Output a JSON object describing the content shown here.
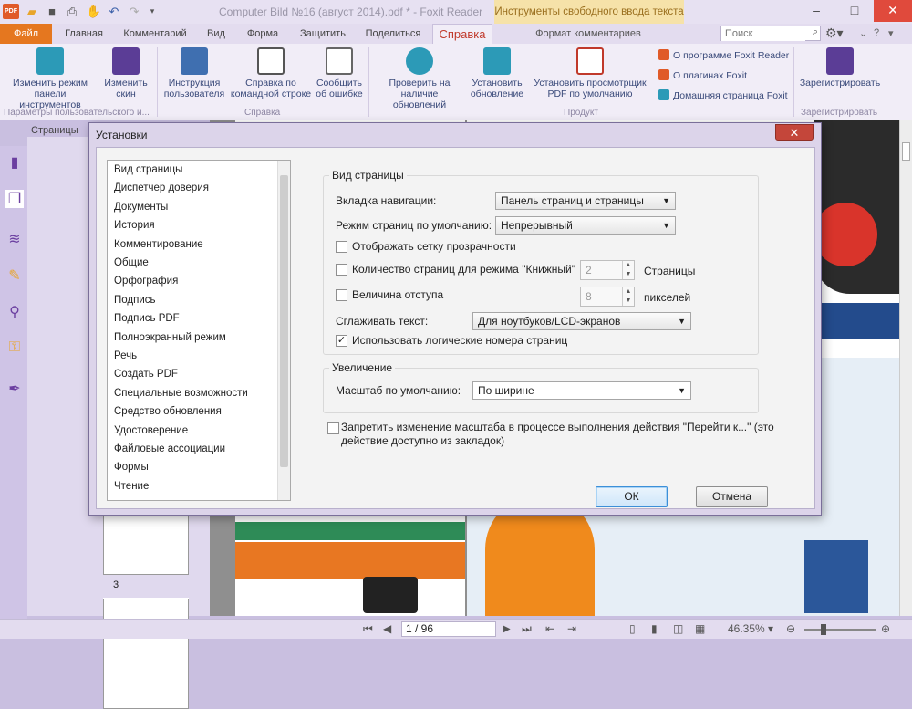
{
  "window": {
    "title": "Computer Bild №16 (август 2014).pdf * - Foxit Reader",
    "context_tab": "Инструменты свободного ввода текста",
    "logo_text": "PDF"
  },
  "tabs": [
    "Файл",
    "Главная",
    "Комментарий",
    "Вид",
    "Форма",
    "Защитить",
    "Поделиться",
    "Справка",
    "Формат комментариев"
  ],
  "search": {
    "placeholder": "Поиск"
  },
  "ribbon": {
    "buttons": [
      {
        "label": "Изменить режим панели инструментов",
        "icon": "toolbar-mode-icon"
      },
      {
        "label": "Изменить скин",
        "icon": "skin-icon"
      },
      {
        "label": "Инструкция пользователя",
        "icon": "user-guide-icon"
      },
      {
        "label": "Справка по командной строке",
        "icon": "command-line-icon"
      },
      {
        "label": "Сообщить об ошибке",
        "icon": "bug-report-icon"
      },
      {
        "label": "Проверить на наличие обновлений",
        "icon": "check-updates-icon"
      },
      {
        "label": "Установить обновление",
        "icon": "install-update-icon"
      },
      {
        "label": "Установить просмотрщик PDF по умолчанию",
        "icon": "default-viewer-icon"
      },
      {
        "label": "Зарегистрировать",
        "icon": "register-icon"
      }
    ],
    "links": [
      "О программе Foxit Reader",
      "О плагинах Foxit",
      "Домашняя страница Foxit"
    ],
    "groups": [
      "Параметры пользовательского и...",
      "Справка",
      "Продукт",
      "Зарегистрировать"
    ]
  },
  "left_panel": {
    "label": "Страницы",
    "page3": "3"
  },
  "dialog": {
    "title": "Установки",
    "close": "✕",
    "categories": [
      "Вид страницы",
      "Диспетчер доверия",
      "Документы",
      "История",
      "Комментирование",
      "Общие",
      "Орфография",
      "Подпись",
      "Подпись PDF",
      "Полноэкранный режим",
      "Речь",
      "Создать PDF",
      "Специальные возможности",
      "Средство обновления",
      "Удостоверение",
      "Файловые ассоциации",
      "Формы",
      "Чтение"
    ],
    "page_view": {
      "group_title": "Вид страницы",
      "nav_tab_label": "Вкладка навигации:",
      "nav_tab_value": "Панель страниц и страницы",
      "page_mode_label": "Режим страниц по умолчанию:",
      "page_mode_value": "Непрерывный",
      "transparency_grid": "Отображать сетку прозрачности",
      "book_pages_label": "Количество страниц для режима \"Книжный\"",
      "book_pages_value": "2",
      "book_pages_unit": "Страницы",
      "indent_label": "Величина отступа",
      "indent_value": "8",
      "indent_unit": "пикселей",
      "smooth_label": "Сглаживать текст:",
      "smooth_value": "Для ноутбуков/LCD-экранов",
      "logical_numbers": "Использовать логические номера страниц"
    },
    "zoom": {
      "group_title": "Увеличение",
      "default_label": "Масштаб по умолчанию:",
      "default_value": "По ширине"
    },
    "forbid_zoom_line1": "Запретить изменение масштаба в процессе выполнения действия \"Перейти к...\" (это",
    "forbid_zoom_line2": "действие доступно из закладок)",
    "ok": "ОК",
    "cancel": "Отмена"
  },
  "status": {
    "page": "1 / 96",
    "zoom": "46.35%"
  }
}
